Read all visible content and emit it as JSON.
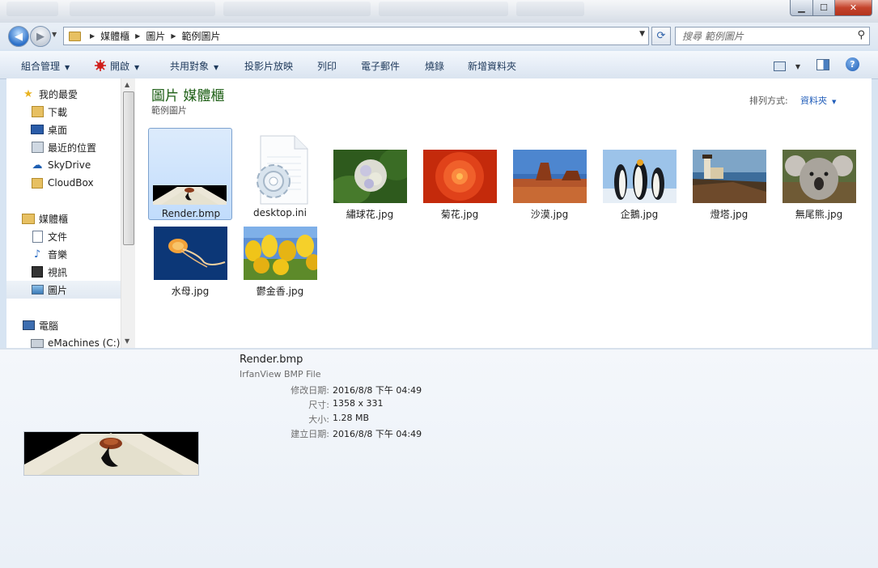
{
  "address": {
    "crumbs": [
      "媒體櫃",
      "圖片",
      "範例圖片"
    ]
  },
  "search": {
    "placeholder": "搜尋 範例圖片"
  },
  "toolbar": {
    "organize": "組合管理",
    "open": "開啟",
    "share": "共用對象",
    "slideshow": "投影片放映",
    "print": "列印",
    "email": "電子郵件",
    "burn": "燒錄",
    "new_folder": "新增資料夾"
  },
  "nav": {
    "favorites": "我的最愛",
    "downloads": "下載",
    "desktop": "桌面",
    "recent": "最近的位置",
    "skydrive": "SkyDrive",
    "cloudbox": "CloudBox",
    "libraries": "媒體櫃",
    "documents": "文件",
    "music": "音樂",
    "videos": "視訊",
    "pictures": "圖片",
    "computer": "電腦",
    "drive_c": "eMachines (C:)"
  },
  "library": {
    "title": "圖片 媒體櫃",
    "subtitle": "範例圖片",
    "arrange_label": "排列方式:",
    "arrange_value": "資料夾"
  },
  "files": [
    {
      "name": "Render.bmp",
      "icon": "render-thumbnail"
    },
    {
      "name": "desktop.ini",
      "icon": "settings-file-icon"
    },
    {
      "name": "繡球花.jpg",
      "icon": "hydrangea-thumbnail"
    },
    {
      "name": "菊花.jpg",
      "icon": "chrysanthemum-thumbnail"
    },
    {
      "name": "沙漠.jpg",
      "icon": "desert-thumbnail"
    },
    {
      "name": "企鵝.jpg",
      "icon": "penguins-thumbnail"
    },
    {
      "name": "燈塔.jpg",
      "icon": "lighthouse-thumbnail"
    },
    {
      "name": "無尾熊.jpg",
      "icon": "koala-thumbnail"
    },
    {
      "name": "水母.jpg",
      "icon": "jellyfish-thumbnail"
    },
    {
      "name": "鬱金香.jpg",
      "icon": "tulips-thumbnail"
    }
  ],
  "details": {
    "name": "Render.bmp",
    "type": "IrfanView BMP File",
    "rows": [
      {
        "label": "修改日期:",
        "value": "2016/8/8 下午 04:49"
      },
      {
        "label": "尺寸:",
        "value": "1358 x 331"
      },
      {
        "label": "大小:",
        "value": "1.28 MB"
      },
      {
        "label": "建立日期:",
        "value": "2016/8/8 下午 04:49"
      }
    ]
  }
}
